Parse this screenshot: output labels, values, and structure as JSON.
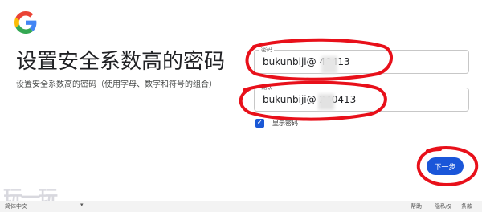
{
  "header": {
    "title": "设置安全系数高的密码",
    "subtitle": "设置安全系数高的密码（使用字母、数字和符号的组合）"
  },
  "form": {
    "password": {
      "label": "密码",
      "value": "bukunbiji@   40413"
    },
    "confirm": {
      "label": "确认",
      "value": "bukunbiji@   240413"
    },
    "show_password": {
      "label": "显示密码",
      "checked": true
    }
  },
  "actions": {
    "next_label": "下一步"
  },
  "footer": {
    "language": "简体中文",
    "links": [
      "帮助",
      "隐私权",
      "条款"
    ]
  },
  "watermark": "玩一玩",
  "colors": {
    "accent": "#1a56d9",
    "annotation": "#e8101a",
    "google_blue": "#4285F4",
    "google_red": "#EA4335",
    "google_yellow": "#FBBC05",
    "google_green": "#34A853"
  },
  "icons": {
    "logo": "google-g-logo",
    "checkbox": "check-icon",
    "language_caret": "caret-down-icon"
  }
}
